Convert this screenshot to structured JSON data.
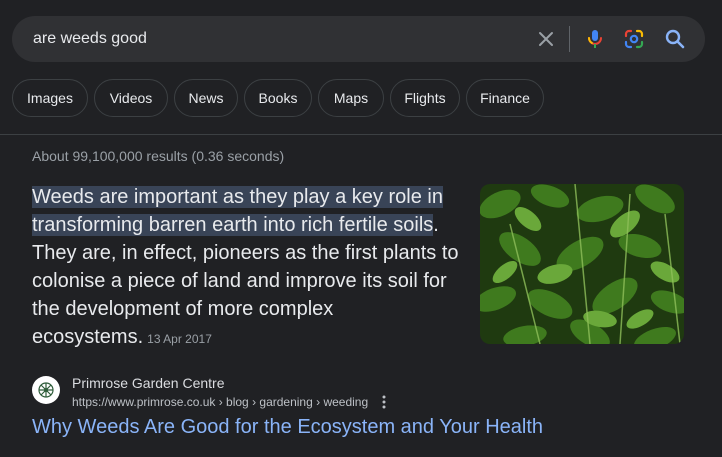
{
  "search": {
    "query": "are weeds good",
    "clear_icon": "close-icon",
    "voice_icon": "microphone-icon",
    "lens_icon": "google-lens-icon",
    "search_icon": "search-icon"
  },
  "chips": [
    {
      "label": "Images"
    },
    {
      "label": "Videos"
    },
    {
      "label": "News"
    },
    {
      "label": "Books"
    },
    {
      "label": "Maps"
    },
    {
      "label": "Flights"
    },
    {
      "label": "Finance"
    }
  ],
  "result_stats": "About 99,100,000 results (0.36 seconds)",
  "featured_snippet": {
    "highlighted": "Weeds are important as they play a key role in transforming barren earth into rich fertile soils",
    "rest": ". They are, in effect, pioneers as the first plants to colonise a piece of land and improve its soil for the development of more complex ecosystems.",
    "date": "13 Apr 2017",
    "image_alt": "nettle weeds photo"
  },
  "source": {
    "site_name": "Primrose Garden Centre",
    "url": "https://www.primrose.co.uk › blog › gardening › weeding",
    "title": "Why Weeds Are Good for the Ecosystem and Your Health"
  },
  "colors": {
    "background": "#202124",
    "search_bg": "#303134",
    "link": "#8ab4f8",
    "highlight": "#394457",
    "text": "#e8eaed",
    "muted": "#9aa0a6"
  }
}
